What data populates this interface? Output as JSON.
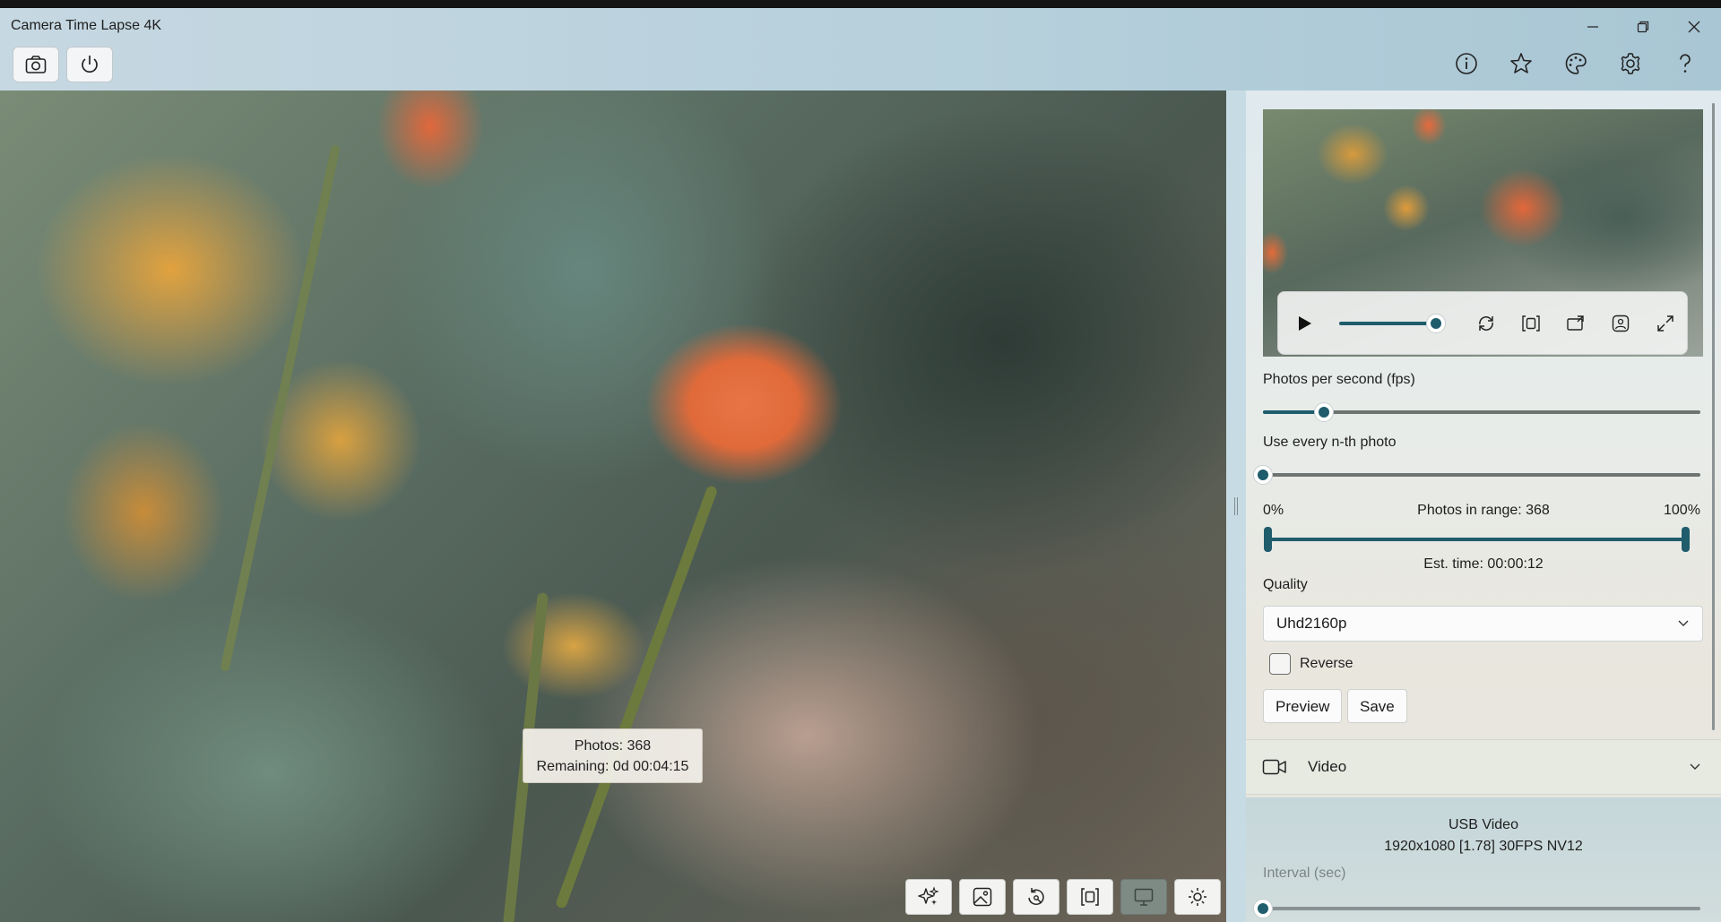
{
  "window": {
    "title": "Camera Time Lapse 4K",
    "controls": [
      "minimize-icon",
      "restore-icon",
      "close-icon"
    ]
  },
  "toolbar": {
    "left_icons": [
      "camera-icon",
      "power-icon"
    ],
    "right_icons": [
      "info-icon",
      "star-icon",
      "palette-icon",
      "gear-icon",
      "help-icon"
    ]
  },
  "viewer": {
    "photos_label": "Photos: 368",
    "remaining_label": "Remaining: 0d 00:04:15",
    "bottom_tools": [
      "magic-sparkle-icon",
      "image-icon",
      "rotate-icon",
      "fit-frame-icon",
      "monitor-icon",
      "brightness-icon"
    ],
    "active_tool": "monitor-icon"
  },
  "panel": {
    "player": {
      "icons": [
        "play-icon",
        "repeat-icon",
        "aspect-icon",
        "cast-icon",
        "snapshot-icon",
        "fullscreen-icon"
      ],
      "volume_fraction": 0.95
    },
    "fps": {
      "label": "Photos per second (fps)",
      "value_fraction": 0.14
    },
    "nth": {
      "label": "Use every n-th photo",
      "value_fraction": 0.0
    },
    "range": {
      "min_label": "0%",
      "max_label": "100%",
      "photos_label": "Photos in range: 368",
      "est_time": "Est. time: 00:00:12",
      "start_fraction": 0.0,
      "end_fraction": 1.0
    },
    "quality": {
      "label": "Quality",
      "selected": "Uhd2160p"
    },
    "reverse": {
      "label": "Reverse",
      "checked": false
    },
    "buttons": {
      "preview": "Preview",
      "save": "Save"
    },
    "video": {
      "header": "Video",
      "device": "USB Video",
      "format": "1920x1080 [1.78] 30FPS NV12",
      "interval_label": "Interval (sec)",
      "interval_fraction": 0.0
    }
  },
  "colors": {
    "accent": "#1f5c6c"
  }
}
